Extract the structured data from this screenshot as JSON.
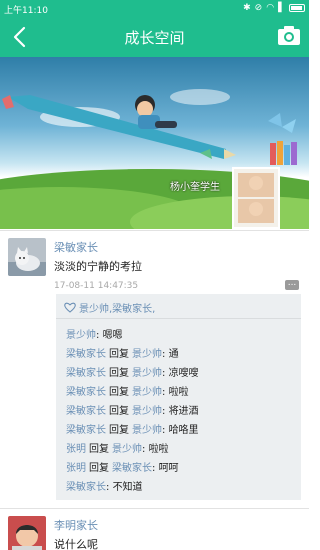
{
  "status_bar": {
    "time": "上午11:10",
    "icons": [
      "✱",
      "⊘",
      "◠",
      "▌"
    ]
  },
  "header": {
    "title": "成长空间"
  },
  "banner": {
    "label": "杨小奎学生"
  },
  "posts": [
    {
      "author": "梁敏家长",
      "content": "淡淡的宁静的考拉",
      "time": "17-08-11 14:47:35",
      "likes": "景少帅,梁敏家长,",
      "comments": [
        {
          "from": "景少帅",
          "to": "",
          "reply_word": "",
          "text": "嗯嗯"
        },
        {
          "from": "梁敏家长",
          "to": "景少帅",
          "reply_word": "回复",
          "text": "通"
        },
        {
          "from": "梁敏家长",
          "to": "景少帅",
          "reply_word": "回复",
          "text": "凉嗖嗖"
        },
        {
          "from": "梁敏家长",
          "to": "景少帅",
          "reply_word": "回复",
          "text": "啦啦"
        },
        {
          "from": "梁敏家长",
          "to": "景少帅",
          "reply_word": "回复",
          "text": "将进酒"
        },
        {
          "from": "梁敏家长",
          "to": "景少帅",
          "reply_word": "回复",
          "text": "哈咯里"
        },
        {
          "from": "张明",
          "to": "景少帅",
          "reply_word": "回复",
          "text": "啦啦"
        },
        {
          "from": "张明",
          "to": "梁敏家长",
          "reply_word": "回复",
          "text": "呵呵"
        },
        {
          "from": "梁敏家长",
          "to": "",
          "reply_word": "",
          "text": "不知道"
        }
      ]
    },
    {
      "author": "李明家长",
      "content": "说什么呢"
    }
  ],
  "separator": ": "
}
